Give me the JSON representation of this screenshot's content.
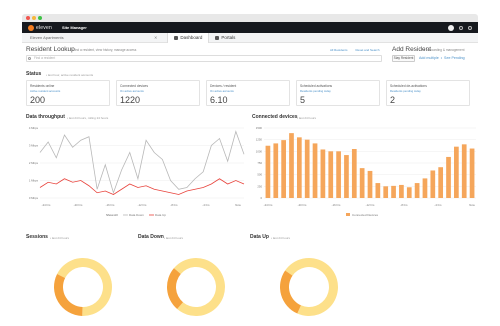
{
  "window": {
    "app_name": "Site Manager",
    "logo_text": "eleven"
  },
  "subbar": {
    "site_placeholder": "Eleven Apartments",
    "tabs": [
      {
        "label": "Dashboard",
        "active": true
      },
      {
        "label": "Portals",
        "active": false
      }
    ]
  },
  "lookup": {
    "title": "Resident Lookup",
    "subtitle": "• find a resident, view history, manage access",
    "links": [
      "All Residents",
      "Reset and Search"
    ],
    "search_placeholder": "Find a resident"
  },
  "add_resident": {
    "title": "Add Resident",
    "subtitle": "• onboarding & management",
    "stay_button": "Stay Resident",
    "link_1": "Add multiple",
    "separator": "•",
    "link_2": "See Pending"
  },
  "status": {
    "title": "Status",
    "subtitle": "• last hour, active resident accounts",
    "cards": [
      {
        "label": "Residents online",
        "link": "Active resident accounts",
        "value": "200"
      },
      {
        "label": "Connected devices",
        "link": "On active accounts",
        "value": "1220"
      },
      {
        "label": "Devices / resident",
        "link": "On active accounts",
        "value": "6.10"
      },
      {
        "label": "Scheduled activations",
        "link": "Residents pending today",
        "value": "5"
      },
      {
        "label": "Scheduled de-activations",
        "link": "Residents pending today",
        "value": "2"
      }
    ]
  },
  "throughput": {
    "title": "Data throughput",
    "subtitle": "• last 24 hours, rolling 24 hours",
    "legend_all": "Show All",
    "legend_down": "Data Down",
    "legend_up": "Data Up"
  },
  "devices_panel": {
    "title": "Connected devices",
    "subtitle": "• last 24 hours",
    "legend": "Connected Devices"
  },
  "donuts": [
    {
      "title": "Sessions",
      "subtitle": "• last 24 hours"
    },
    {
      "title": "Data Down",
      "subtitle": "• last 24 hours"
    },
    {
      "title": "Data Up",
      "subtitle": "• last 24 hours"
    }
  ],
  "colors": {
    "accent": "#f47d20",
    "link": "#4a90c8",
    "line_down": "#b8b8b8",
    "line_up": "#e8423b",
    "bar": "#f5a65b",
    "donut_light": "#fde08a",
    "donut_dark": "#f5a23c"
  },
  "chart_data": [
    {
      "type": "line",
      "title": "Data throughput",
      "x": [
        "-24 hrs",
        "-20 hrs",
        "-16 hrs",
        "-12 hrs",
        "-8 hrs",
        "-4 hrs",
        "Now"
      ],
      "y_ticks": [
        "0 Mbps",
        "1 Mbps",
        "2 Mbps",
        "3 Mbps",
        "4 Mbps"
      ],
      "ylim": [
        0,
        4
      ],
      "series": [
        {
          "name": "Data Down",
          "color": "#b8b8b8",
          "values": [
            2.6,
            3.2,
            2.3,
            3.6,
            2.9,
            3.3,
            3.5,
            0.5,
            1.9,
            0.3,
            1.6,
            2.6,
            1.1,
            3.3,
            2.6,
            2.2,
            1.0,
            0.5,
            0.6,
            1.1,
            1.5,
            3.0,
            3.4,
            2.1,
            3.8,
            2.5
          ]
        },
        {
          "name": "Data Up",
          "color": "#e8423b",
          "values": [
            0.6,
            0.9,
            0.8,
            1.1,
            0.9,
            1.0,
            0.7,
            0.3,
            0.4,
            0.2,
            0.5,
            0.8,
            0.6,
            0.7,
            0.5,
            0.4,
            0.3,
            0.2,
            0.4,
            0.5,
            0.6,
            0.8,
            1.1,
            0.8,
            1.0,
            0.8
          ]
        }
      ]
    },
    {
      "type": "bar",
      "title": "Connected devices",
      "x": [
        "-24 hrs",
        "-20 hrs",
        "-16 hrs",
        "-12 hrs",
        "-8 hrs",
        "-4 hrs",
        "Now"
      ],
      "y_ticks": [
        "0",
        "250",
        "500",
        "750",
        "1000",
        "1250",
        "1500"
      ],
      "ylim": [
        0,
        1500
      ],
      "series": [
        {
          "name": "Connected Devices",
          "color": "#f5a65b",
          "values": [
            1120,
            1170,
            1240,
            1390,
            1300,
            1250,
            1170,
            1040,
            1000,
            1000,
            920,
            1050,
            640,
            580,
            320,
            250,
            260,
            280,
            230,
            320,
            420,
            590,
            660,
            880,
            1100,
            1150,
            1060
          ]
        }
      ]
    },
    {
      "type": "pie",
      "title": "Sessions",
      "values": [
        68,
        32
      ],
      "colors": [
        "#fde08a",
        "#f5a23c"
      ]
    },
    {
      "type": "pie",
      "title": "Data Down",
      "values": [
        75,
        25
      ],
      "colors": [
        "#fde08a",
        "#f5a23c"
      ]
    },
    {
      "type": "pie",
      "title": "Data Up",
      "values": [
        72,
        28
      ],
      "colors": [
        "#fde08a",
        "#f5a23c"
      ]
    }
  ]
}
